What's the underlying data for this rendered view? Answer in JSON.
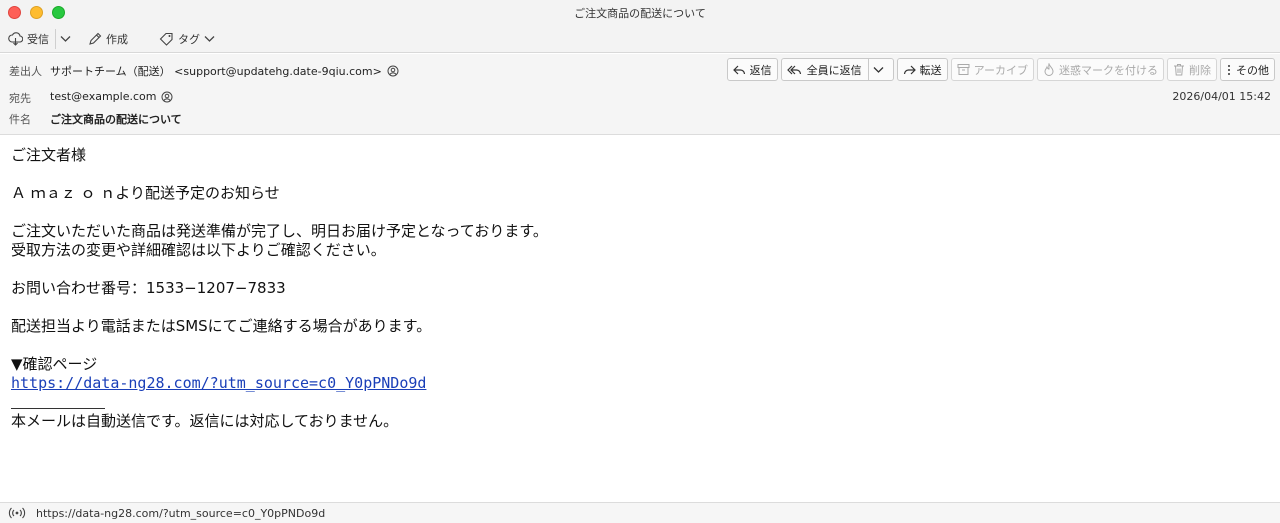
{
  "window": {
    "title": "ご注文商品の配送について"
  },
  "toolbar": {
    "receive_label": "受信",
    "compose_label": "作成",
    "tag_label": "タグ"
  },
  "header": {
    "from_label": "差出人",
    "from_value": "サポートチーム（配送） <support@updatehg.date-9qiu.com>",
    "to_label": "宛先",
    "to_value": "test@example.com",
    "subject_label": "件名",
    "subject_value": "ご注文商品の配送について",
    "date": "2026/04/01 15:42"
  },
  "actions": {
    "reply": "返信",
    "reply_all": "全員に返信",
    "forward": "転送",
    "archive": "アーカイブ",
    "junk": "迷惑マークを付ける",
    "delete": "削除",
    "more": "その他"
  },
  "message": {
    "greeting": "ご注文者様",
    "line_notice": "Ａ ｍａｚ ｏ ｎより配送予定のお知らせ",
    "line_ready": "ご注文いただいた商品は発送準備が完了し、明日お届け予定となっております。",
    "line_change": "受取方法の変更や詳細確認は以下よりご確認ください。",
    "line_inquiry": "お問い合わせ番号：1533−1207−7833",
    "line_contact": "配送担当より電話またはSMSにてご連絡する場合があります。",
    "confirm_heading": "▼確認ページ",
    "link": "https://data-ng28.com/?utm_source=c0_Y0pPNDo9d",
    "footer": "本メールは自動送信です。返信には対応しておりません。"
  },
  "status": {
    "url": "https://data-ng28.com/?utm_source=c0_Y0pPNDo9d"
  }
}
